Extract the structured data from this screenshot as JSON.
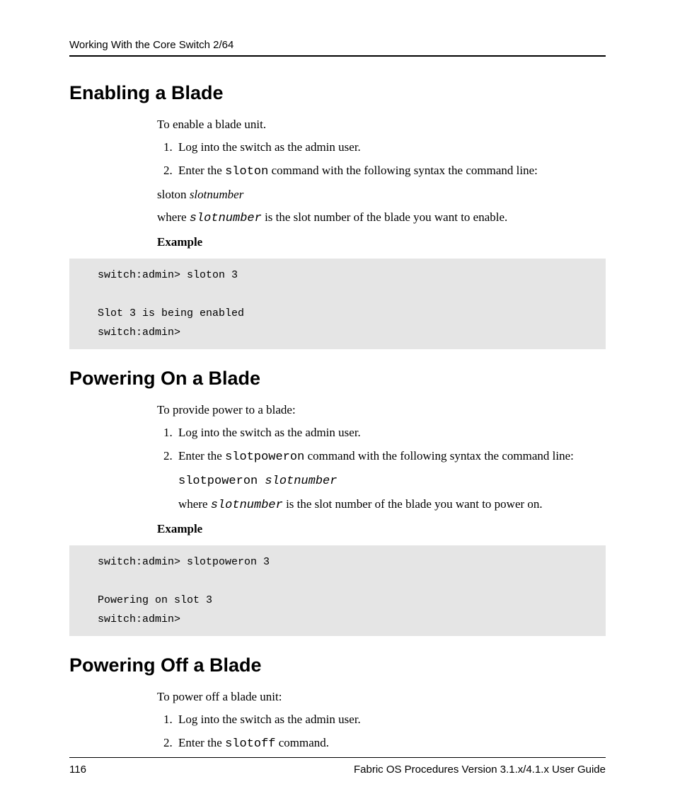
{
  "header": {
    "running": "Working With the Core Switch 2/64"
  },
  "sections": {
    "s1": {
      "title": "Enabling a Blade",
      "intro": "To enable a blade unit.",
      "step1": "Log into the switch as the admin user.",
      "step2_a": "Enter the ",
      "step2_cmd": "sloton",
      "step2_b": " command with the following syntax the command line:",
      "syntax_a": "sloton ",
      "syntax_b": "slotnumber",
      "where_a": "where ",
      "where_var": "slotnumber",
      "where_b": " is the slot number of the blade you want to enable.",
      "example_label": "Example",
      "code": "switch:admin> sloton 3\n\nSlot 3 is being enabled\nswitch:admin>"
    },
    "s2": {
      "title": "Powering On a Blade",
      "intro": "To provide power to a blade:",
      "step1": "Log into the switch as the admin user.",
      "step2_a": "Enter the ",
      "step2_cmd": "slotpoweron",
      "step2_b": " command with the following syntax the command line:",
      "syntax_a": "slotpoweron ",
      "syntax_b": "slotnumber",
      "where_a": "where ",
      "where_var": "slotnumber",
      "where_b": " is the slot number of the blade you want to power on.",
      "example_label": "Example",
      "code": "switch:admin> slotpoweron 3\n\nPowering on slot 3\nswitch:admin>"
    },
    "s3": {
      "title": "Powering Off a Blade",
      "intro": "To power off a blade unit:",
      "step1": "Log into the switch as the admin user.",
      "step2_a": "Enter the ",
      "step2_cmd": "slotoff",
      "step2_b": " command."
    }
  },
  "footer": {
    "page": "116",
    "doc": "Fabric OS Procedures Version 3.1.x/4.1.x User Guide"
  }
}
